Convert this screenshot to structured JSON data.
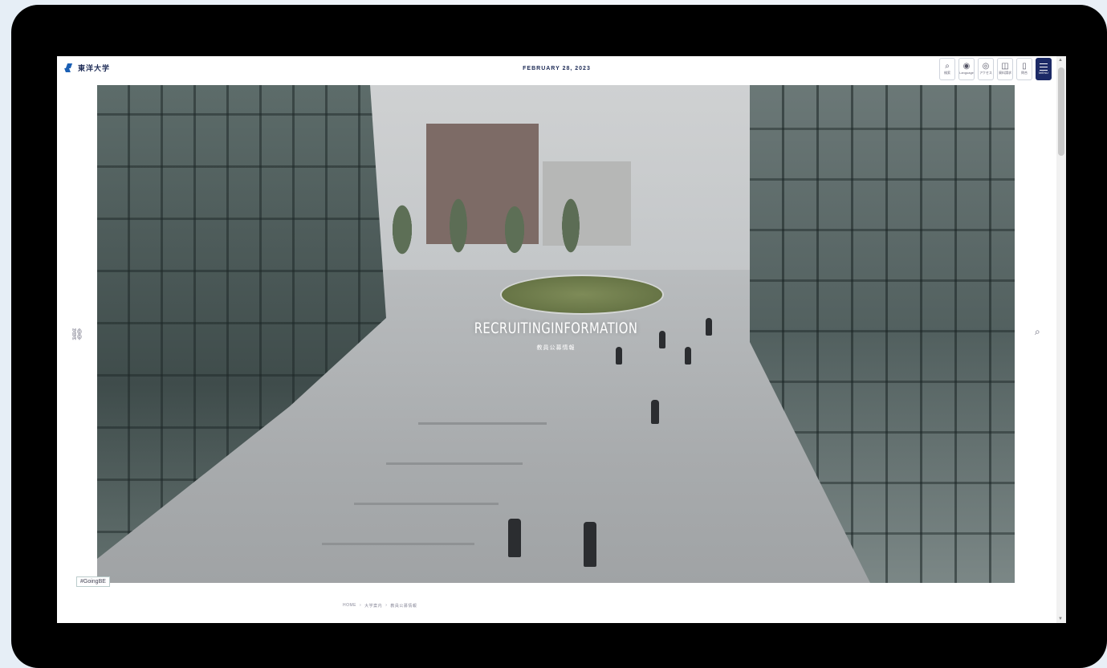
{
  "site": {
    "logo_text": "東洋大学",
    "date": "FEBRUARY 28, 2023"
  },
  "tools": [
    {
      "icon": "search-icon",
      "glyph": "⌕",
      "label": "検索"
    },
    {
      "icon": "globe-icon",
      "glyph": "◉",
      "label": "Language"
    },
    {
      "icon": "access-icon",
      "glyph": "◎",
      "label": "アクセス"
    },
    {
      "icon": "info-icon",
      "glyph": "◫",
      "label": "資料請求"
    },
    {
      "icon": "contact-icon",
      "glyph": "▯",
      "label": "問合"
    },
    {
      "icon": "menu-icon",
      "label": "MENU"
    }
  ],
  "hero": {
    "title": "RECRUITINGINFORMATION",
    "subtitle": "教員公募情報"
  },
  "side": {
    "left_glyph": "⛓",
    "right_glyph": "⌕"
  },
  "tag": "#GoingBE",
  "breadcrumb": [
    "HOME",
    "大学案内",
    "教員公募情報"
  ],
  "colors": {
    "brand": "#1c2a66",
    "accent": "#1a5fb4"
  }
}
